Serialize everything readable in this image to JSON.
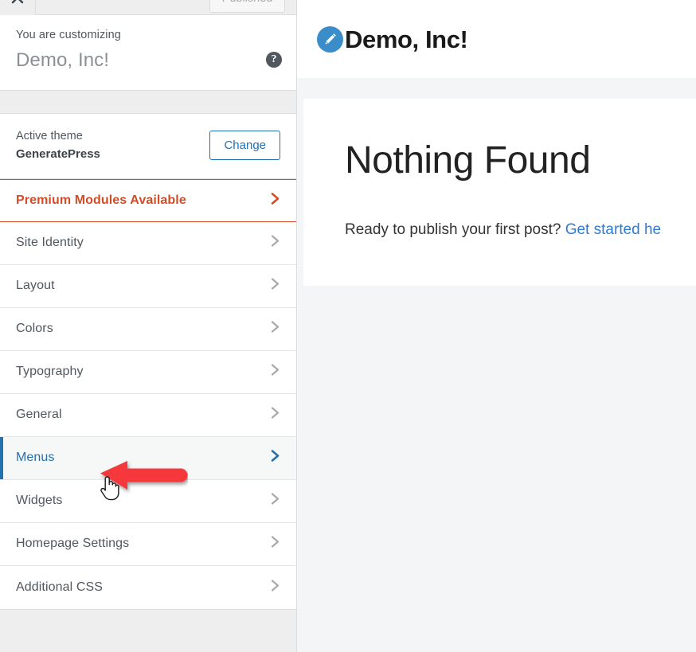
{
  "customizer": {
    "topbar": {
      "close_label": "Close",
      "close_icon": "close-x-icon",
      "publish_label": "Published"
    },
    "header": {
      "customizing_label": "You are customizing",
      "site_title": "Demo, Inc!",
      "help_label": "?",
      "help_icon": "help-question-icon"
    },
    "theme": {
      "active_label": "Active theme",
      "name": "GeneratePress",
      "change_label": "Change"
    },
    "panels": [
      {
        "label": "Premium Modules Available",
        "state": "premium",
        "chevron": "chevron-right-icon"
      },
      {
        "label": "Site Identity",
        "state": "default",
        "chevron": "chevron-right-icon"
      },
      {
        "label": "Layout",
        "state": "default",
        "chevron": "chevron-right-icon"
      },
      {
        "label": "Colors",
        "state": "default",
        "chevron": "chevron-right-icon"
      },
      {
        "label": "Typography",
        "state": "default",
        "chevron": "chevron-right-icon"
      },
      {
        "label": "General",
        "state": "default",
        "chevron": "chevron-right-icon"
      },
      {
        "label": "Menus",
        "state": "active",
        "chevron": "chevron-right-icon"
      },
      {
        "label": "Widgets",
        "state": "default",
        "chevron": "chevron-right-icon"
      },
      {
        "label": "Homepage Settings",
        "state": "default",
        "chevron": "chevron-right-icon"
      },
      {
        "label": "Additional CSS",
        "state": "default",
        "chevron": "chevron-right-icon"
      }
    ]
  },
  "preview": {
    "brand": {
      "icon": "pencil-edit-icon",
      "title": "Demo, Inc!"
    },
    "content": {
      "heading": "Nothing Found",
      "body_text": "Ready to publish your first post? ",
      "link_text": "Get started he"
    }
  },
  "annotations": {
    "arrow": {
      "name": "red-pointer-arrow",
      "direction": "left",
      "color": "#f4373a"
    },
    "cursor": {
      "name": "hand-pointer-cursor"
    }
  },
  "colors": {
    "accent_blue": "#2271b1",
    "premium_orange": "#d24d27",
    "link_blue": "#2f7bd4",
    "brand_blue": "#3a8dc9",
    "arrow_red": "#f4373a",
    "sidebar_gray": "#eeeeee",
    "preview_bg": "#f4f5f7"
  }
}
